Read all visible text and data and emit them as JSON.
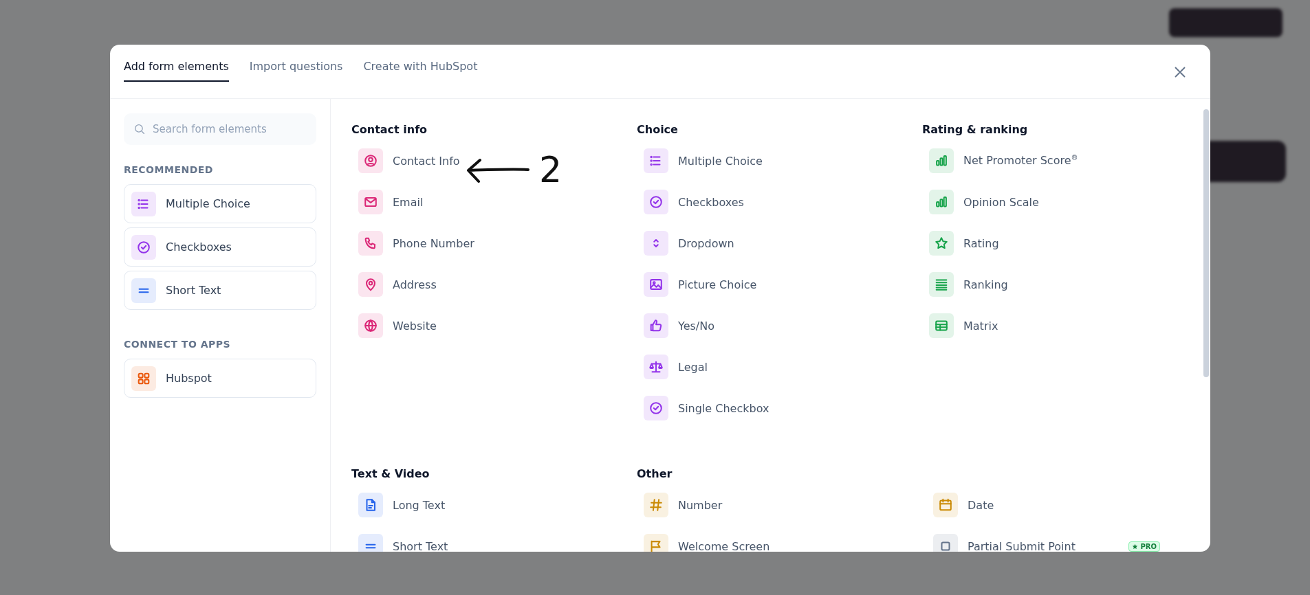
{
  "tabs": [
    {
      "label": "Add form elements",
      "selected": true
    },
    {
      "label": "Import questions",
      "selected": false
    },
    {
      "label": "Create with HubSpot",
      "selected": false
    }
  ],
  "search": {
    "placeholder": "Search form elements"
  },
  "sidebar_groups": [
    {
      "title": "RECOMMENDED",
      "items": [
        {
          "label": "Multiple Choice",
          "kind": "list",
          "color": "#9333ea"
        },
        {
          "label": "Checkboxes",
          "kind": "check",
          "color": "#9333ea"
        },
        {
          "label": "Short Text",
          "kind": "lines",
          "color": "#2563eb"
        }
      ]
    },
    {
      "title": "CONNECT TO APPS",
      "items": [
        {
          "label": "Hubspot",
          "kind": "apps",
          "color": "#ea580c"
        }
      ]
    }
  ],
  "sections": [
    {
      "title": "Contact info",
      "items": [
        {
          "label": "Contact Info",
          "kind": "person",
          "color": "#db2777"
        },
        {
          "label": "Email",
          "kind": "mail",
          "color": "#db2777"
        },
        {
          "label": "Phone Number",
          "kind": "phone",
          "color": "#db2777"
        },
        {
          "label": "Address",
          "kind": "pin",
          "color": "#db2777"
        },
        {
          "label": "Website",
          "kind": "globe",
          "color": "#db2777"
        }
      ]
    },
    {
      "title": "Choice",
      "items": [
        {
          "label": "Multiple Choice",
          "kind": "list",
          "color": "#9333ea"
        },
        {
          "label": "Checkboxes",
          "kind": "check",
          "color": "#9333ea"
        },
        {
          "label": "Dropdown",
          "kind": "updown",
          "color": "#9333ea"
        },
        {
          "label": "Picture Choice",
          "kind": "image",
          "color": "#9333ea"
        },
        {
          "label": "Yes/No",
          "kind": "thumb",
          "color": "#9333ea"
        },
        {
          "label": "Legal",
          "kind": "scale",
          "color": "#9333ea"
        },
        {
          "label": "Single Checkbox",
          "kind": "check",
          "color": "#9333ea"
        }
      ]
    },
    {
      "title": "Rating & ranking",
      "items": [
        {
          "label": "Net Promoter Score$^{®}$",
          "kind": "bars",
          "color": "#16a34a"
        },
        {
          "label": "Opinion Scale",
          "kind": "bars",
          "color": "#16a34a"
        },
        {
          "label": "Rating",
          "kind": "star",
          "color": "#16a34a"
        },
        {
          "label": "Ranking",
          "kind": "stack",
          "color": "#16a34a"
        },
        {
          "label": "Matrix",
          "kind": "table",
          "color": "#16a34a"
        }
      ]
    },
    {
      "title": "Text & Video",
      "items": [
        {
          "label": "Long Text",
          "kind": "doc",
          "color": "#2563eb"
        },
        {
          "label": "Short Text",
          "kind": "lines",
          "color": "#2563eb"
        }
      ]
    },
    {
      "title": "Other",
      "items": [
        {
          "label": "Number",
          "kind": "hash",
          "color": "#ca8a04"
        },
        {
          "label": "Date",
          "kind": "calendar",
          "color": "#ca8a04"
        },
        {
          "label": "Welcome Screen",
          "kind": "flag",
          "color": "#ca8a04"
        },
        {
          "label": "Partial Submit Point",
          "kind": "square",
          "color": "#64748b",
          "badge": "PRO"
        }
      ]
    }
  ],
  "annotation": {
    "label": "2"
  }
}
